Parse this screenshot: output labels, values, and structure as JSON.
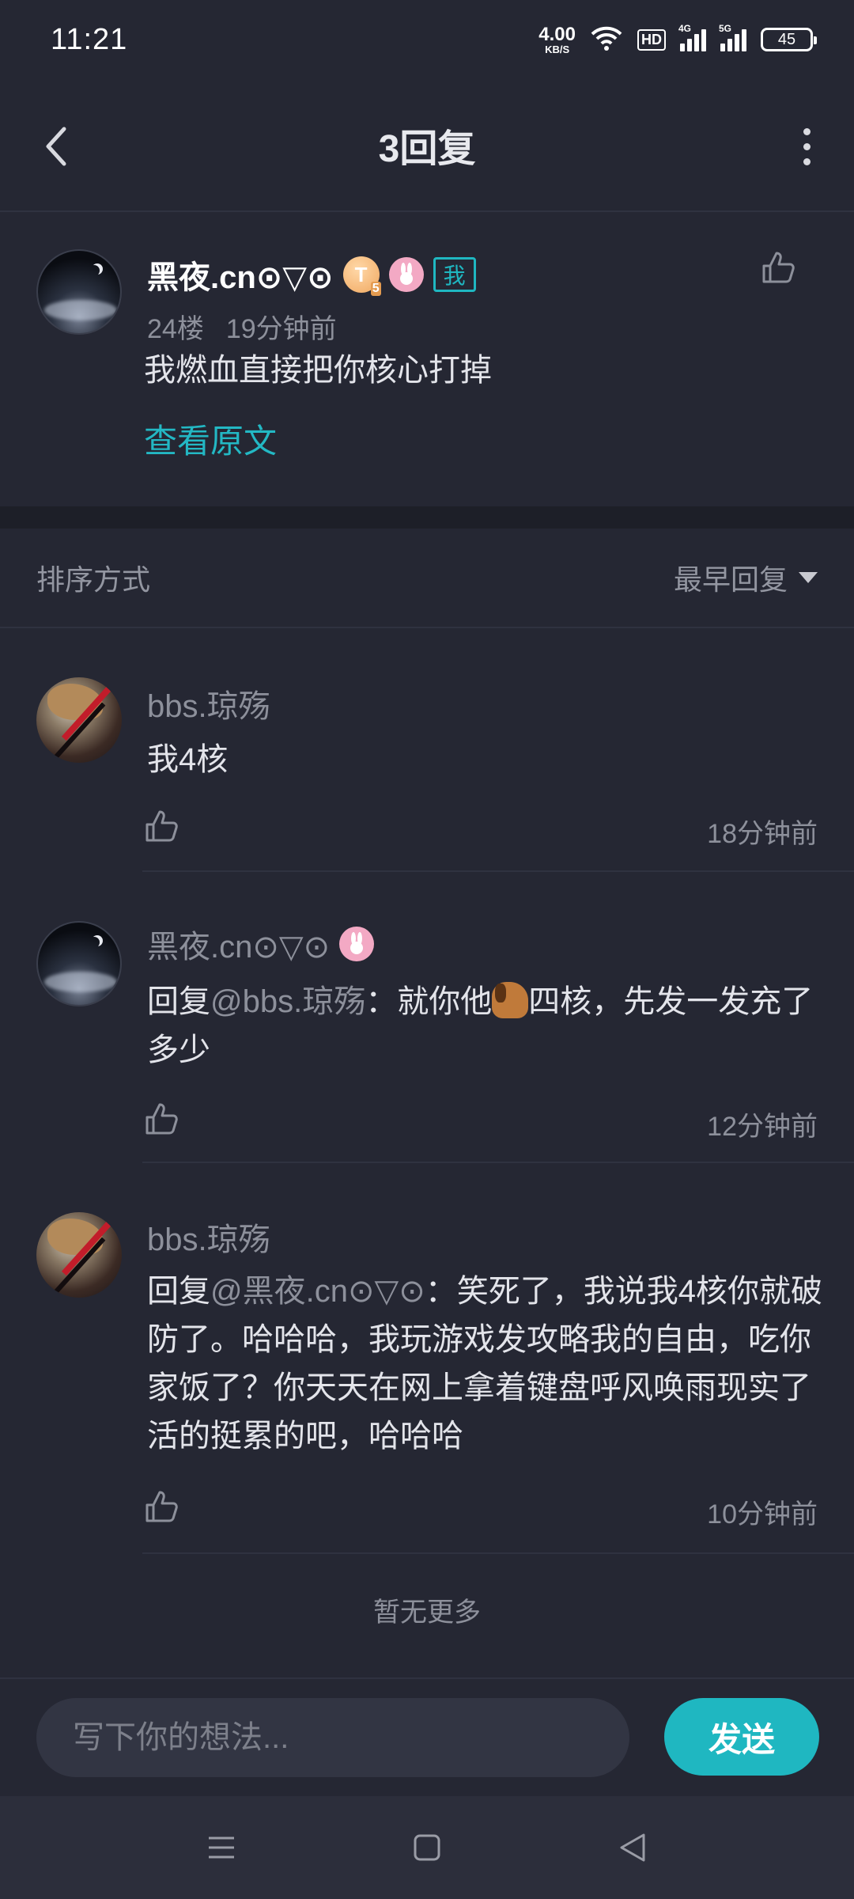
{
  "status_bar": {
    "time": "11:21",
    "net_speed_value": "4.00",
    "net_speed_unit": "KB/S",
    "hd_label": "HD",
    "sig1_label": "4G",
    "sig2_label": "5G",
    "battery": "45"
  },
  "header": {
    "title": "3回复"
  },
  "original_post": {
    "username": "黑夜.cn⊙▽⊙",
    "level_badge": "T",
    "level_num": "5",
    "me_badge": "我",
    "floor": "24楼",
    "time": "19分钟前",
    "text": "我燃血直接把你核心打掉",
    "view_original": "查看原文"
  },
  "sort": {
    "label": "排序方式",
    "value": "最早回复"
  },
  "replies": [
    {
      "username": "bbs.琼殇",
      "text": "我4核",
      "prefix": "",
      "mention": "",
      "time": "18分钟前"
    },
    {
      "username": "黑夜.cn⊙▽⊙",
      "prefix": "回复",
      "mention": "@bbs.琼殇",
      "text_part1": "：就你他",
      "text_part2": "四核，先发一发充了多少",
      "time": "12分钟前"
    },
    {
      "username": "bbs.琼殇",
      "prefix": "回复",
      "mention": "@黑夜.cn⊙▽⊙",
      "text": "：笑死了，我说我4核你就破防了。哈哈哈，我玩游戏发攻略我的自由，吃你家饭了？你天天在网上拿着键盘呼风唤雨现实了活的挺累的吧，哈哈哈",
      "time": "10分钟前"
    }
  ],
  "no_more": "暂无更多",
  "composer": {
    "placeholder": "写下你的想法...",
    "send_label": "发送"
  },
  "colors": {
    "accent": "#1fb7c1",
    "background": "#252733"
  }
}
